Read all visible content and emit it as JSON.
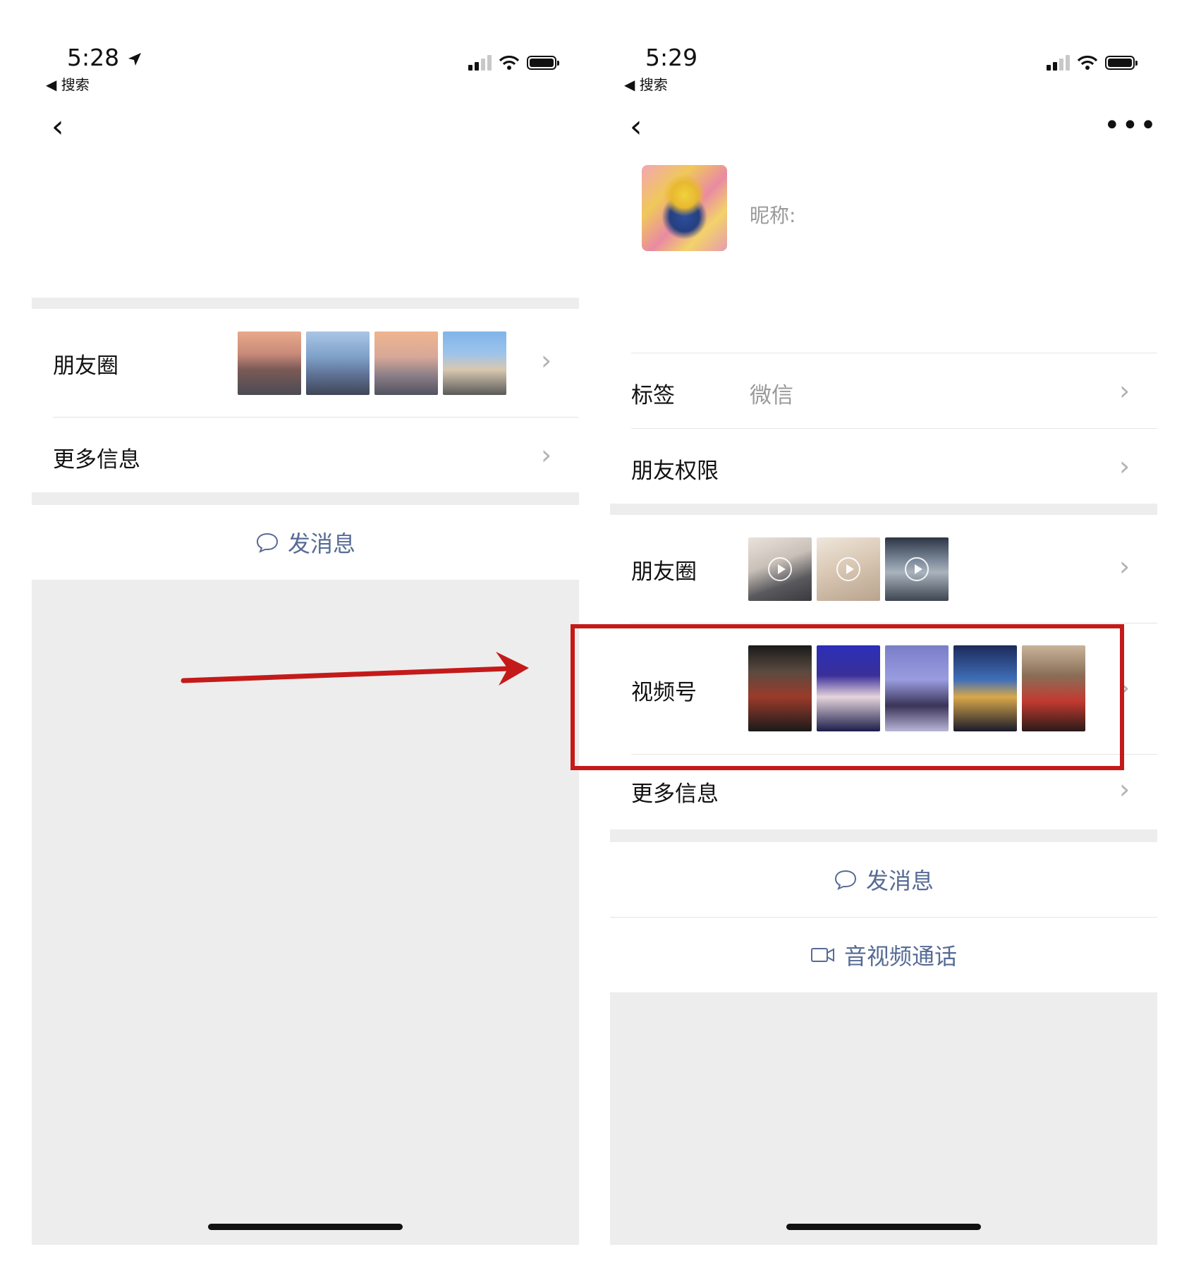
{
  "left": {
    "status": {
      "time": "5:28",
      "location_icon": "location-arrow-icon",
      "back_app_label": "◀ 搜索"
    },
    "nav": {
      "back_icon": "chevron-left-icon"
    },
    "moments": {
      "label": "朋友圈",
      "thumbnail_count": 4
    },
    "more_info": {
      "label": "更多信息"
    },
    "send_message": {
      "label": "发消息",
      "icon": "chat-bubble-icon"
    }
  },
  "right": {
    "status": {
      "time": "5:29",
      "back_app_label": "◀ 搜索"
    },
    "nav": {
      "back_icon": "chevron-left-icon",
      "more_icon": "more-dots-icon"
    },
    "profile": {
      "nickname_label": "昵称:"
    },
    "tags": {
      "label": "标签",
      "value": "微信"
    },
    "friend_permissions": {
      "label": "朋友权限"
    },
    "moments": {
      "label": "朋友圈",
      "thumbnail_count": 3,
      "video": true
    },
    "channels": {
      "label": "视频号",
      "thumbnail_count": 5
    },
    "more_info": {
      "label": "更多信息"
    },
    "send_message": {
      "label": "发消息",
      "icon": "chat-bubble-icon"
    },
    "av_call": {
      "label": "音视频通话",
      "icon": "video-camera-icon"
    }
  },
  "annotation": {
    "arrow_color": "#c41a1a",
    "highlight_color": "#c41a1a"
  },
  "colors": {
    "link_blue": "#576b95",
    "gap_gray": "#ededed",
    "chevron": "#b2b2b2"
  }
}
